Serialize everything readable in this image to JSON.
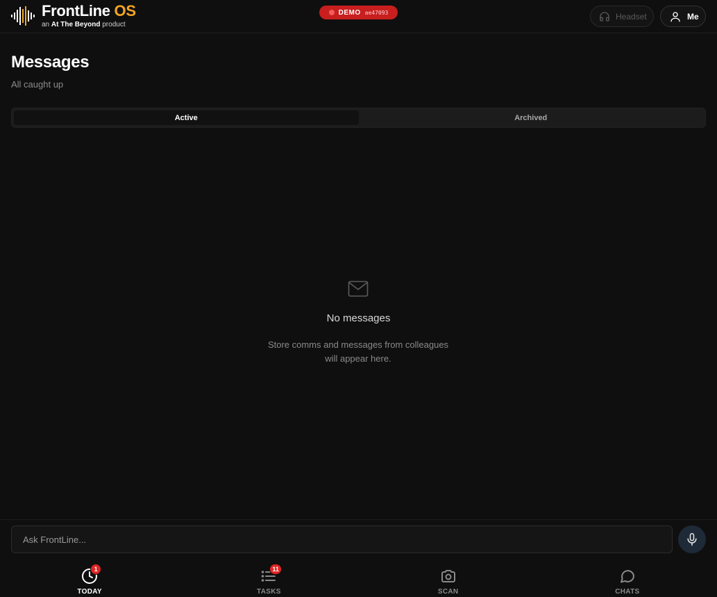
{
  "header": {
    "brand_name": "FrontLine",
    "brand_suffix": "OS",
    "brand_prefix": "an",
    "brand_company": "At The Beyond",
    "brand_suffix_text": "product",
    "demo_label": "DEMO",
    "demo_code": "ae47093",
    "headset_label": "Headset",
    "me_label": "Me"
  },
  "page": {
    "title": "Messages",
    "subtitle": "All caught up"
  },
  "tabs": [
    {
      "label": "Active",
      "active": true
    },
    {
      "label": "Archived",
      "active": false
    }
  ],
  "empty_state": {
    "title": "No messages",
    "description_line1": "Store comms and messages from colleagues",
    "description_line2": "will appear here.",
    "icon": "mail-icon"
  },
  "ask_bar": {
    "placeholder": "Ask FrontLine...",
    "value": "",
    "mic_icon": "microphone-icon"
  },
  "bottom_nav": [
    {
      "label": "TODAY",
      "icon": "clock-icon",
      "badge": "1",
      "active": true
    },
    {
      "label": "TASKS",
      "icon": "list-icon",
      "badge": "11",
      "active": false
    },
    {
      "label": "SCAN",
      "icon": "camera-icon",
      "badge": "",
      "active": false
    },
    {
      "label": "CHATS",
      "icon": "chat-bubble-icon",
      "badge": "",
      "active": false
    }
  ],
  "colors": {
    "background": "#0f0f0f",
    "brand_accent": "#f5a524",
    "demo_badge": "#c81e1e",
    "notification_badge": "#e02424"
  }
}
